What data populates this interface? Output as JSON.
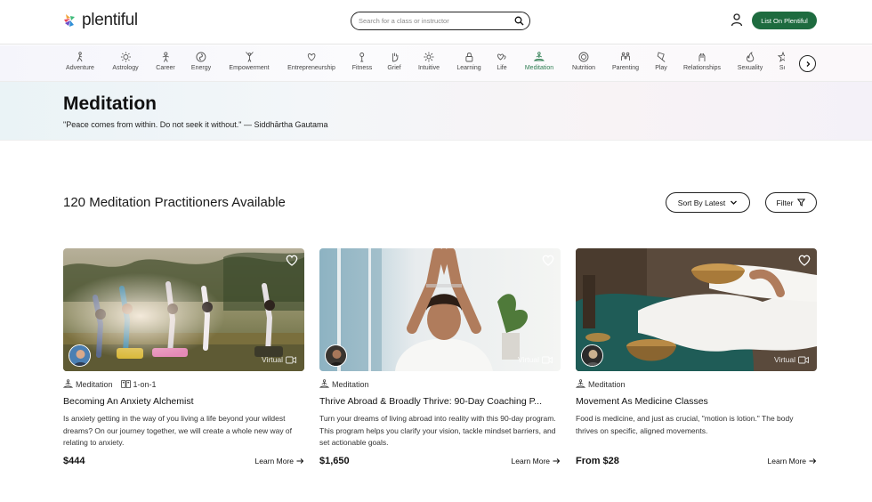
{
  "header": {
    "logo_text": "plentiful",
    "search_placeholder": "Search for a class or instructor",
    "list_button": "List On Plentiful"
  },
  "categories": [
    {
      "label": "Adventure",
      "icon": "hiker-icon"
    },
    {
      "label": "Astrology",
      "icon": "sun-icon"
    },
    {
      "label": "Career",
      "icon": "person-icon"
    },
    {
      "label": "Energy",
      "icon": "swirl-icon"
    },
    {
      "label": "Empowerment",
      "icon": "raised-arms-icon"
    },
    {
      "label": "Entrepreneurship",
      "icon": "heart-badge-icon"
    },
    {
      "label": "Fitness",
      "icon": "kettlebell-icon"
    },
    {
      "label": "Grief",
      "icon": "hand-icon"
    },
    {
      "label": "Intuitive",
      "icon": "eye-burst-icon"
    },
    {
      "label": "Learning",
      "icon": "lock-icon"
    },
    {
      "label": "Life",
      "icon": "hearts-icon"
    },
    {
      "label": "Meditation",
      "icon": "meditation-icon",
      "active": true
    },
    {
      "label": "Nutrition",
      "icon": "plate-icon"
    },
    {
      "label": "Parenting",
      "icon": "family-icon"
    },
    {
      "label": "Play",
      "icon": "kite-icon"
    },
    {
      "label": "Relationships",
      "icon": "hands-icon"
    },
    {
      "label": "Sexuality",
      "icon": "flame-icon"
    },
    {
      "label": "Sc",
      "icon": "star-icon"
    }
  ],
  "hero": {
    "title": "Meditation",
    "quote": "\"Peace comes from within. Do not seek it without.\" — Siddhārtha Gautama"
  },
  "results": {
    "count_text": "120 Meditation Practitioners Available",
    "sort_label": "Sort By Latest",
    "filter_label": "Filter"
  },
  "cards": [
    {
      "tags": [
        "Meditation",
        "1-on-1"
      ],
      "title": "Becoming An Anxiety Alchemist",
      "description": "Is anxiety getting in the way of you living a life beyond your wildest dreams? On our journey together, we will create a whole new way of relating to anxiety.",
      "price": "$444",
      "more": "Learn More",
      "badge": "Virtual"
    },
    {
      "tags": [
        "Meditation"
      ],
      "title": "Thrive Abroad & Broadly Thrive: 90-Day Coaching P...",
      "description": "Turn your dreams of living abroad into reality with this 90-day program. This program helps you clarify your vision, tackle mindset barriers, and set actionable goals.",
      "price": "$1,650",
      "more": "Learn More",
      "badge": "Virtual"
    },
    {
      "tags": [
        "Meditation"
      ],
      "title": "Movement As Medicine Classes",
      "description": "Food is medicine, and just as crucial, \"motion is lotion.\" The body thrives on specific, aligned movements.",
      "price": "From $28",
      "more": "Learn More",
      "badge": "Virtual"
    }
  ],
  "colors": {
    "brand_green": "#1e6b3f",
    "active_category": "#2e7d52"
  }
}
